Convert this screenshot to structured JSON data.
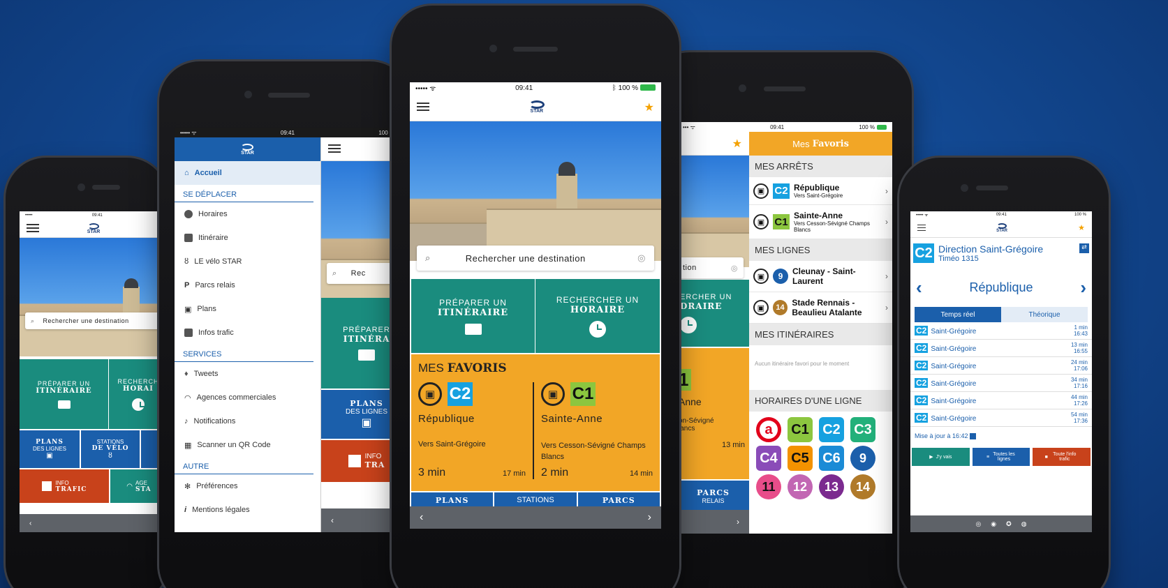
{
  "status": {
    "time": "09:41",
    "battery": "100 %"
  },
  "logo_text": "STAR",
  "search_placeholder": "Rechercher une destination",
  "home": {
    "prep_small": "PRÉPARER UN",
    "prep_big": "ITINÉRAIRE",
    "rech_small": "RECHERCHER UN",
    "rech_big": "HORAIRE",
    "fav_title_a": "MES",
    "fav_title_b": "FAVORIS",
    "fav1": {
      "line": "C2",
      "stop": "République",
      "dir": "Vers Saint-Grégoire",
      "t1": "3 min",
      "t2": "17 min"
    },
    "fav2": {
      "line": "C1",
      "stop": "Sainte-Anne",
      "dir": "Vers Cesson-Sévigné Champs Blancs",
      "t1": "2 min",
      "t2": "14 min"
    },
    "plans": "PLANS",
    "stations": "STATIONS",
    "parcs": "PARCS"
  },
  "left": {
    "prep_small": "PRÉPARER UN",
    "prep_big": "ITINÉRAIRE",
    "rech_small": "RECHERCH",
    "rech_big": "HORAI",
    "plans_a": "PLANS",
    "plans_b": "DES LIGNES",
    "stations_a": "STATIONS",
    "stations_b": "DE VÉLO",
    "info_a": "INFO",
    "info_b": "TRAFIC",
    "agences_a": "AGE",
    "agences_b": "STA"
  },
  "menu": {
    "home": "Accueil",
    "sec1": "SE DÉPLACER",
    "items1": [
      "Horaires",
      "Itinéraire",
      "LE vélo STAR",
      "Parcs relais",
      "Plans",
      "Infos trafic"
    ],
    "sec2": "SERVICES",
    "items2": [
      "Tweets",
      "Agences commerciales",
      "Notifications",
      "Scanner un QR Code"
    ],
    "sec3": "AUTRE",
    "items3": [
      "Préférences",
      "Mentions légales"
    ],
    "peek_prep": "PRÉPARER",
    "peek_itin": "ITINÉRA",
    "peek_search": "Rec",
    "peek_plans": "PLANS",
    "peek_plans_b": "DES LIGNES",
    "peek_info": "INFO",
    "peek_info_b": "TRA"
  },
  "favs": {
    "title_a": "Mes",
    "title_b": "Favoris",
    "sec_arrets": "MES ARRÊTS",
    "arret1": {
      "line": "C2",
      "name": "République",
      "dir": "Vers Saint-Grégoire"
    },
    "arret2": {
      "line": "C1",
      "name": "Sainte-Anne",
      "dir": "Vers Cesson-Sévigné Champs Blancs"
    },
    "sec_lignes": "MES LIGNES",
    "ligne1": {
      "line": "9",
      "name": "Cleunay - Saint-Laurent"
    },
    "ligne2": {
      "line": "14",
      "name": "Stade Rennais - Beaulieu Atalante"
    },
    "sec_itin": "MES ITINÉRAIRES",
    "itin_empty": "Aucun itinéraire favori pour le moment",
    "sec_horaires": "HORAIRES D'UNE LIGNE",
    "lines": [
      "a",
      "C1",
      "C2",
      "C3",
      "C4",
      "C5",
      "C6",
      "9",
      "11",
      "12",
      "13",
      "14"
    ],
    "peek_tion": "tion",
    "peek_rech": "ERCHER UN",
    "peek_hor": "DRAIRE",
    "peek_c1": "1",
    "peek_anne": "Anne",
    "peek_dir": "on-Sévigné",
    "peek_dir2": "lancs",
    "peek_13": "13 min",
    "peek_parcs": "PARCS",
    "peek_relais": "RELAIS"
  },
  "detail": {
    "line": "C2",
    "direction": "Direction Saint-Grégoire",
    "timeo": "Timéo 1315",
    "stop": "République",
    "tab1": "Temps réel",
    "tab2": "Théorique",
    "rows": [
      {
        "dest": "Saint-Grégoire",
        "a": "1 min",
        "b": "16:43"
      },
      {
        "dest": "Saint-Grégoire",
        "a": "13 min",
        "b": "16:55"
      },
      {
        "dest": "Saint-Grégoire",
        "a": "24 min",
        "b": "17:06"
      },
      {
        "dest": "Saint-Grégoire",
        "a": "34 min",
        "b": "17:16"
      },
      {
        "dest": "Saint-Grégoire",
        "a": "44 min",
        "b": "17:26"
      },
      {
        "dest": "Saint-Grégoire",
        "a": "54 min",
        "b": "17:36"
      }
    ],
    "updated": "Mise à jour à 16:42",
    "btn1": "J'y vais",
    "btn2": "Toutes les lignes",
    "btn3": "Toute l'info trafic"
  },
  "colors": {
    "teal": "#1a8c7e",
    "orange": "#f2a626",
    "blue": "#1b5fab",
    "red": "#c8421b",
    "c1": "#8cc63f",
    "c2": "#16a1e0",
    "c3": "#22b07a",
    "c4": "#8a4cb8",
    "c5": "#f39200",
    "c6": "#1b8bd6",
    "l9": "#1b5fab",
    "l11": "#e84d8a",
    "l12": "#c266b3",
    "l13": "#7b2a8f",
    "l14": "#b07a2a",
    "metro": "#e2001a"
  }
}
